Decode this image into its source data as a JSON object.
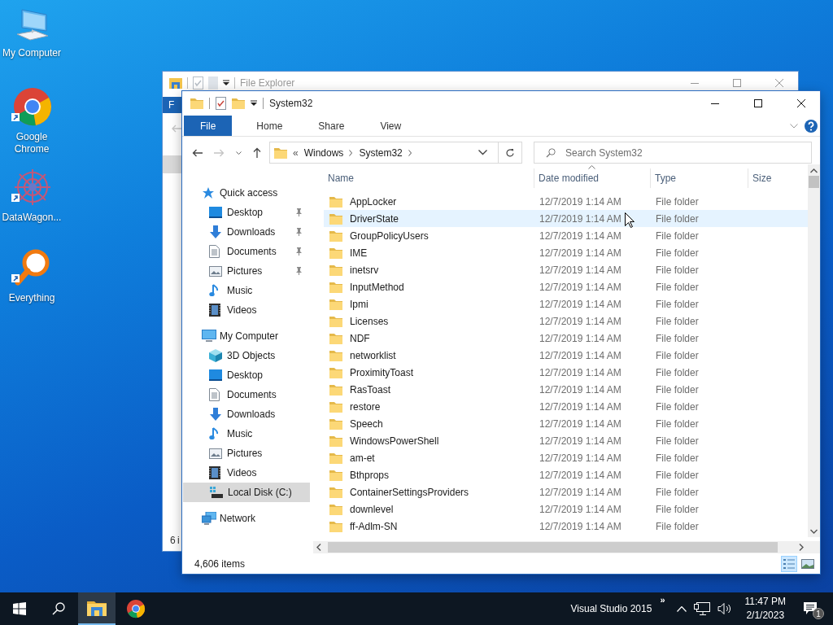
{
  "desktop_icons": [
    {
      "label": "My Computer",
      "kind": "computer",
      "shortcut": false
    },
    {
      "label": "Google Chrome",
      "kind": "chrome",
      "shortcut": true
    },
    {
      "label": "DataWagon...",
      "kind": "datawagon",
      "shortcut": true
    },
    {
      "label": "Everything",
      "kind": "everything",
      "shortcut": true
    }
  ],
  "back_window": {
    "title": "File Explorer",
    "ribbon_tab": "F",
    "status": "6 i"
  },
  "window": {
    "title": "System32",
    "ribbon_tabs": [
      {
        "label": "File",
        "selected": true
      },
      {
        "label": "Home",
        "selected": false
      },
      {
        "label": "Share",
        "selected": false
      },
      {
        "label": "View",
        "selected": false
      }
    ],
    "address": {
      "overflow": "«",
      "path": [
        "Windows",
        "System32"
      ]
    },
    "search": {
      "placeholder": "Search System32"
    },
    "sidebar": [
      {
        "label": "Quick access",
        "kind": "star",
        "selected": false,
        "children": [
          {
            "label": "Desktop",
            "kind": "desktop",
            "pinned": true,
            "selected": false
          },
          {
            "label": "Downloads",
            "kind": "download",
            "pinned": true,
            "selected": false
          },
          {
            "label": "Documents",
            "kind": "document",
            "pinned": true,
            "selected": false
          },
          {
            "label": "Pictures",
            "kind": "picture",
            "pinned": true,
            "selected": false
          },
          {
            "label": "Music",
            "kind": "music",
            "pinned": false,
            "selected": false
          },
          {
            "label": "Videos",
            "kind": "video",
            "pinned": false,
            "selected": false
          }
        ]
      },
      {
        "label": "My Computer",
        "kind": "computer",
        "selected": false,
        "children": [
          {
            "label": "3D Objects",
            "kind": "cube",
            "selected": false
          },
          {
            "label": "Desktop",
            "kind": "desktop",
            "selected": false
          },
          {
            "label": "Documents",
            "kind": "document",
            "selected": false
          },
          {
            "label": "Downloads",
            "kind": "download",
            "selected": false
          },
          {
            "label": "Music",
            "kind": "music",
            "selected": false
          },
          {
            "label": "Pictures",
            "kind": "picture",
            "selected": false
          },
          {
            "label": "Videos",
            "kind": "video",
            "selected": false
          },
          {
            "label": "Local Disk (C:)",
            "kind": "disk",
            "selected": true
          }
        ]
      },
      {
        "label": "Network",
        "kind": "network",
        "selected": false
      }
    ],
    "columns": [
      {
        "label": "Name",
        "sorted": false
      },
      {
        "label": "Date modified",
        "sorted": true
      },
      {
        "label": "Type",
        "sorted": false
      },
      {
        "label": "Size",
        "sorted": false
      }
    ],
    "rows": [
      {
        "name": "AppLocker",
        "date": "12/7/2019 1:14 AM",
        "type": "File folder",
        "hovered": false
      },
      {
        "name": "DriverState",
        "date": "12/7/2019 1:14 AM",
        "type": "File folder",
        "hovered": true
      },
      {
        "name": "GroupPolicyUsers",
        "date": "12/7/2019 1:14 AM",
        "type": "File folder",
        "hovered": false
      },
      {
        "name": "IME",
        "date": "12/7/2019 1:14 AM",
        "type": "File folder",
        "hovered": false
      },
      {
        "name": "inetsrv",
        "date": "12/7/2019 1:14 AM",
        "type": "File folder",
        "hovered": false
      },
      {
        "name": "InputMethod",
        "date": "12/7/2019 1:14 AM",
        "type": "File folder",
        "hovered": false
      },
      {
        "name": "Ipmi",
        "date": "12/7/2019 1:14 AM",
        "type": "File folder",
        "hovered": false
      },
      {
        "name": "Licenses",
        "date": "12/7/2019 1:14 AM",
        "type": "File folder",
        "hovered": false
      },
      {
        "name": "NDF",
        "date": "12/7/2019 1:14 AM",
        "type": "File folder",
        "hovered": false
      },
      {
        "name": "networklist",
        "date": "12/7/2019 1:14 AM",
        "type": "File folder",
        "hovered": false
      },
      {
        "name": "ProximityToast",
        "date": "12/7/2019 1:14 AM",
        "type": "File folder",
        "hovered": false
      },
      {
        "name": "RasToast",
        "date": "12/7/2019 1:14 AM",
        "type": "File folder",
        "hovered": false
      },
      {
        "name": "restore",
        "date": "12/7/2019 1:14 AM",
        "type": "File folder",
        "hovered": false
      },
      {
        "name": "Speech",
        "date": "12/7/2019 1:14 AM",
        "type": "File folder",
        "hovered": false
      },
      {
        "name": "WindowsPowerShell",
        "date": "12/7/2019 1:14 AM",
        "type": "File folder",
        "hovered": false
      },
      {
        "name": "am-et",
        "date": "12/7/2019 1:14 AM",
        "type": "File folder",
        "hovered": false
      },
      {
        "name": "Bthprops",
        "date": "12/7/2019 1:14 AM",
        "type": "File folder",
        "hovered": false
      },
      {
        "name": "ContainerSettingsProviders",
        "date": "12/7/2019 1:14 AM",
        "type": "File folder",
        "hovered": false
      },
      {
        "name": "downlevel",
        "date": "12/7/2019 1:14 AM",
        "type": "File folder",
        "hovered": false
      },
      {
        "name": "ff-Adlm-SN",
        "date": "12/7/2019 1:14 AM",
        "type": "File folder",
        "hovered": false
      }
    ],
    "status": "4,606 items",
    "views": [
      {
        "kind": "details",
        "selected": true
      },
      {
        "kind": "thumbnails",
        "selected": false
      }
    ]
  },
  "taskbar": {
    "apps": [
      {
        "kind": "explorer",
        "active": true
      },
      {
        "kind": "chrome",
        "active": false
      }
    ],
    "toolbar": "Visual Studio 2015",
    "toolbar_expand": "»",
    "time": "11:47 PM",
    "date": "2/1/2023",
    "notifications": "1"
  }
}
